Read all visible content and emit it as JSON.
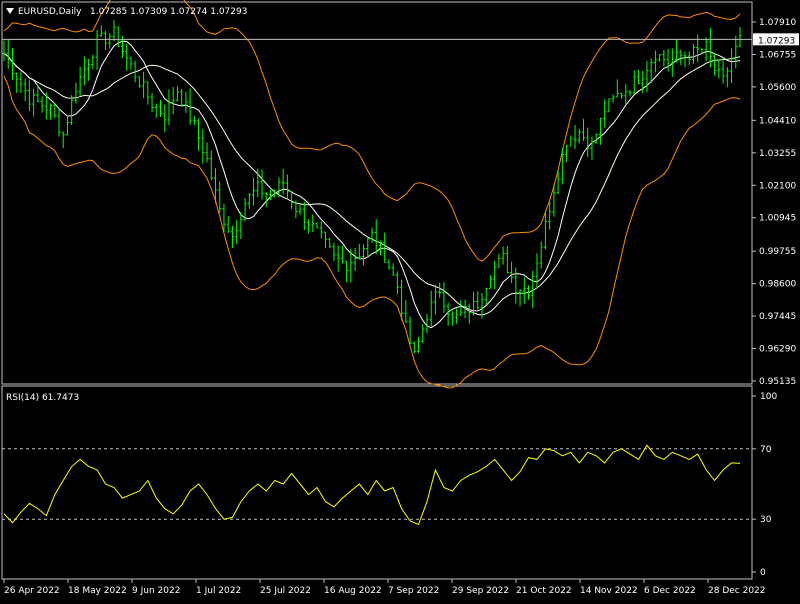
{
  "header": {
    "symbol_label": "EURUSD,Daily",
    "ohlc": "1.07285 1.07309 1.07274 1.07293",
    "indicator_label": "RSI(14) 61.7473"
  },
  "colors": {
    "background": "#000000",
    "frame": "#c0c0c0",
    "candle": "#00ff00",
    "bollinger": "#ff8c00",
    "ma_fast": "#ffffff",
    "ma_slow": "#ffffe0",
    "rsi": "#ffff00",
    "level_line": "#c0c0c0",
    "price_box_bg": "#ffffff",
    "price_box_fg": "#000000"
  },
  "icons": {
    "menu_arrow": "triangle-down-icon"
  },
  "chart_data": [
    {
      "type": "candlestick",
      "title": "EURUSD,Daily",
      "price_ticks": [
        "1.07910",
        "1.06755",
        "1.05600",
        "1.04410",
        "1.03255",
        "1.02100",
        "1.00945",
        "0.99755",
        "0.98600",
        "0.97445",
        "0.96290",
        "0.95135"
      ],
      "ylim": [
        0.95135,
        1.0791
      ],
      "current_price": "1.07293",
      "x_ticks": [
        "26 Apr 2022",
        "18 May 2022",
        "9 Jun 2022",
        "1 Jul 2022",
        "25 Jul 2022",
        "16 Aug 2022",
        "7 Sep 2022",
        "29 Sep 2022",
        "21 Oct 2022",
        "14 Nov 2022",
        "6 Dec 2022",
        "28 Dec 2022"
      ],
      "close_path": [
        [
          0,
          1.068
        ],
        [
          6,
          1.052
        ],
        [
          11,
          1.048
        ],
        [
          14,
          1.039
        ],
        [
          17,
          1.056
        ],
        [
          22,
          1.072
        ],
        [
          26,
          1.075
        ],
        [
          29,
          1.066
        ],
        [
          32,
          1.058
        ],
        [
          35,
          1.05
        ],
        [
          38,
          1.046
        ],
        [
          41,
          1.055
        ],
        [
          45,
          1.042
        ],
        [
          48,
          1.03
        ],
        [
          51,
          1.012
        ],
        [
          54,
          1.003
        ],
        [
          57,
          1.015
        ],
        [
          60,
          1.02
        ],
        [
          63,
          1.017
        ],
        [
          66,
          1.022
        ],
        [
          69,
          1.013
        ],
        [
          72,
          1.008
        ],
        [
          75,
          1.002
        ],
        [
          78,
          0.995
        ],
        [
          81,
          0.993
        ],
        [
          84,
          0.997
        ],
        [
          87,
          1.003
        ],
        [
          90,
          0.996
        ],
        [
          93,
          0.985
        ],
        [
          95,
          0.97
        ],
        [
          97,
          0.96
        ],
        [
          100,
          0.975
        ],
        [
          103,
          0.984
        ],
        [
          106,
          0.973
        ],
        [
          109,
          0.976
        ],
        [
          112,
          0.979
        ],
        [
          115,
          0.99
        ],
        [
          118,
          0.995
        ],
        [
          121,
          0.985
        ],
        [
          124,
          0.984
        ],
        [
          127,
          1.0
        ],
        [
          130,
          1.02
        ],
        [
          133,
          1.037
        ],
        [
          136,
          1.04
        ],
        [
          139,
          1.035
        ],
        [
          142,
          1.048
        ],
        [
          145,
          1.053
        ],
        [
          148,
          1.056
        ],
        [
          151,
          1.061
        ],
        [
          154,
          1.068
        ],
        [
          157,
          1.065
        ],
        [
          160,
          1.067
        ],
        [
          163,
          1.068
        ],
        [
          166,
          1.07
        ],
        [
          168,
          1.062
        ],
        [
          170,
          1.058
        ],
        [
          172,
          1.066
        ],
        [
          174,
          1.0729
        ]
      ]
    },
    {
      "type": "line",
      "title": "RSI(14) 61.7473",
      "y_ticks": [
        "100",
        "70",
        "30",
        "0"
      ],
      "ylim": [
        0,
        100
      ],
      "levels": [
        70,
        30
      ],
      "series": [
        {
          "values": [
            [
              0,
              33
            ],
            [
              2,
              28
            ],
            [
              4,
              34
            ],
            [
              6,
              39
            ],
            [
              8,
              36
            ],
            [
              10,
              32
            ],
            [
              12,
              44
            ],
            [
              14,
              52
            ],
            [
              16,
              60
            ],
            [
              18,
              64
            ],
            [
              20,
              60
            ],
            [
              22,
              58
            ],
            [
              24,
              50
            ],
            [
              26,
              48
            ],
            [
              28,
              42
            ],
            [
              30,
              44
            ],
            [
              32,
              46
            ],
            [
              34,
              52
            ],
            [
              36,
              42
            ],
            [
              38,
              36
            ],
            [
              40,
              33
            ],
            [
              42,
              38
            ],
            [
              44,
              46
            ],
            [
              46,
              50
            ],
            [
              48,
              44
            ],
            [
              50,
              36
            ],
            [
              52,
              30
            ],
            [
              54,
              31
            ],
            [
              56,
              40
            ],
            [
              58,
              46
            ],
            [
              60,
              50
            ],
            [
              62,
              46
            ],
            [
              64,
              52
            ],
            [
              66,
              50
            ],
            [
              68,
              56
            ],
            [
              70,
              50
            ],
            [
              72,
              44
            ],
            [
              74,
              48
            ],
            [
              76,
              40
            ],
            [
              78,
              37
            ],
            [
              80,
              42
            ],
            [
              82,
              46
            ],
            [
              84,
              50
            ],
            [
              86,
              44
            ],
            [
              88,
              52
            ],
            [
              90,
              46
            ],
            [
              92,
              48
            ],
            [
              94,
              36
            ],
            [
              96,
              29
            ],
            [
              98,
              27
            ],
            [
              100,
              40
            ],
            [
              102,
              58
            ],
            [
              104,
              48
            ],
            [
              106,
              46
            ],
            [
              108,
              52
            ],
            [
              110,
              55
            ],
            [
              112,
              57
            ],
            [
              114,
              60
            ],
            [
              116,
              64
            ],
            [
              118,
              58
            ],
            [
              120,
              52
            ],
            [
              122,
              57
            ],
            [
              124,
              65
            ],
            [
              126,
              64
            ],
            [
              128,
              70
            ],
            [
              130,
              69
            ],
            [
              132,
              66
            ],
            [
              134,
              68
            ],
            [
              136,
              62
            ],
            [
              138,
              68
            ],
            [
              140,
              66
            ],
            [
              142,
              62
            ],
            [
              144,
              68
            ],
            [
              146,
              70
            ],
            [
              148,
              67
            ],
            [
              150,
              64
            ],
            [
              152,
              72
            ],
            [
              154,
              66
            ],
            [
              156,
              64
            ],
            [
              158,
              68
            ],
            [
              160,
              66
            ],
            [
              162,
              64
            ],
            [
              164,
              67
            ],
            [
              166,
              58
            ],
            [
              168,
              52
            ],
            [
              170,
              58
            ],
            [
              172,
              62
            ],
            [
              174,
              61.7
            ]
          ]
        }
      ]
    }
  ]
}
